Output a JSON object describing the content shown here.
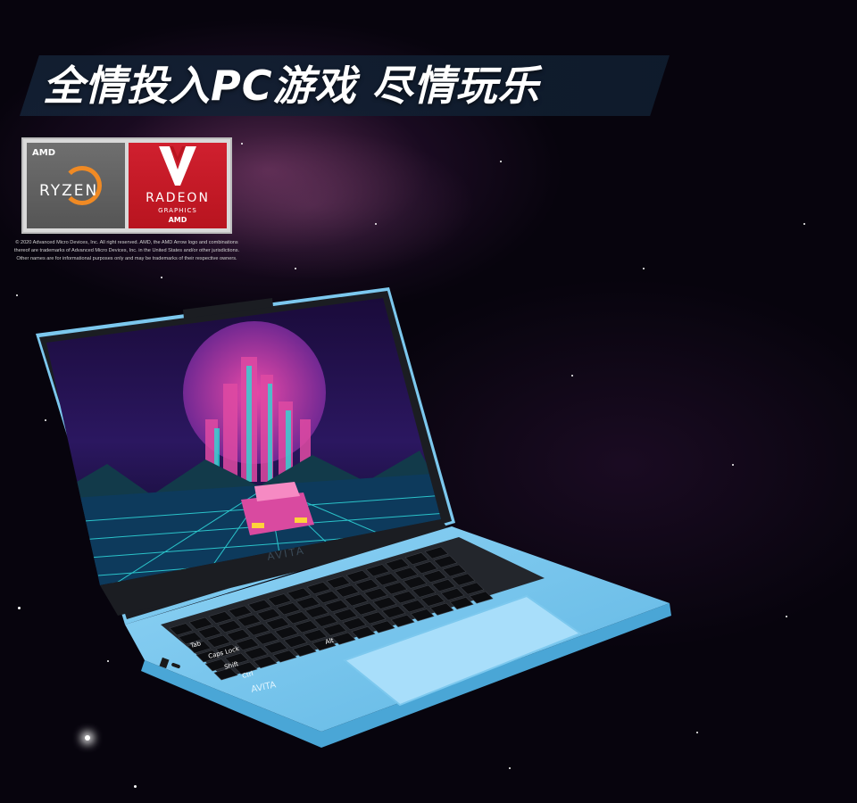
{
  "headline": "全情投入PC游戏 尽情玩乐",
  "badges": {
    "ryzen": {
      "maker": "AMD",
      "name": "RYZEN"
    },
    "radeon": {
      "name": "RADEON",
      "sub": "GRAPHICS",
      "maker": "AMD"
    }
  },
  "legal_text": "© 2020 Advanced Micro Devices, Inc. All right reserved. AMD, the AMD Arrow logo and combinations thereof are trademarks of Advanced Micro Devices, Inc. in the United States and/or other jurisdictions. Other names are for informational purposes only and may be trademarks of their respective owners.",
  "laptop": {
    "brand_bezel": "AVITA",
    "brand_palmrest": "AVITA",
    "color": "#7cc8ee",
    "keys": {
      "tab": "Tab",
      "caps": "Caps Lock",
      "shift": "Shift",
      "ctrl": "Ctrl",
      "alt": "Alt"
    }
  },
  "colors": {
    "background": "#07040d",
    "banner": "#14233a",
    "radeon_red": "#c8182a",
    "ryzen_gray": "#606060",
    "ryzen_orange": "#f08a24"
  }
}
